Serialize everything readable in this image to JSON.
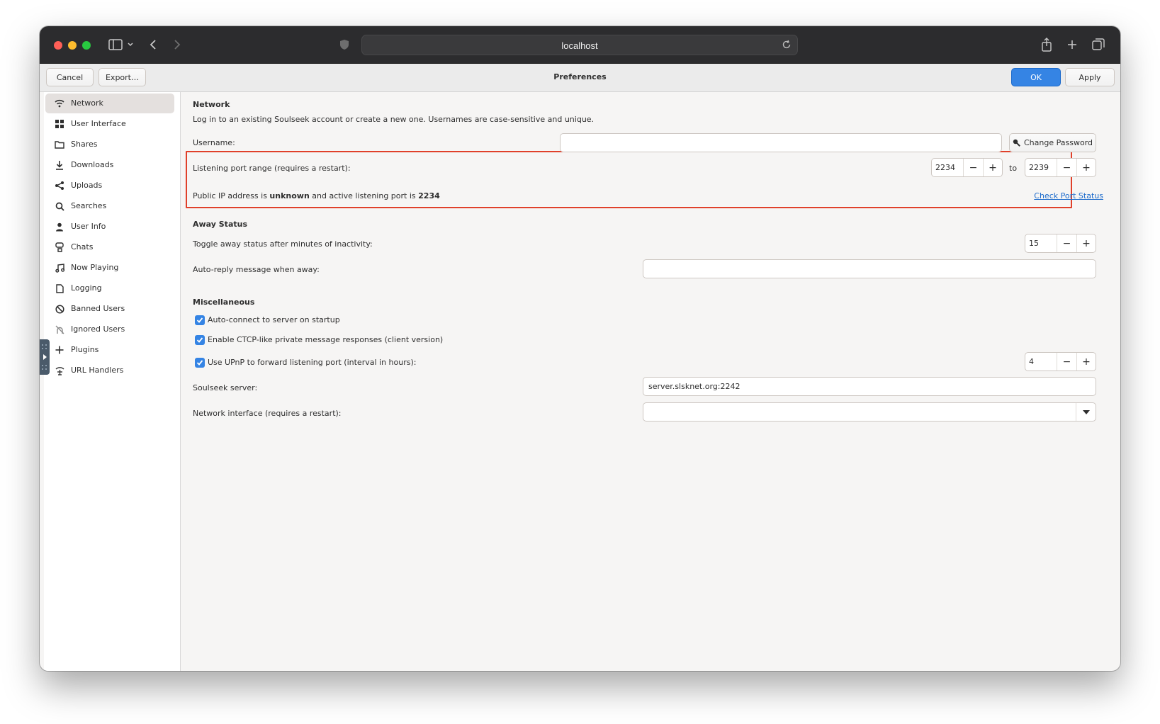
{
  "browser": {
    "url": "localhost"
  },
  "header": {
    "cancel_label": "Cancel",
    "export_label": "Export…",
    "title": "Preferences",
    "ok_label": "OK",
    "apply_label": "Apply"
  },
  "sidebar": {
    "items": [
      {
        "label": "Network",
        "icon": "wifi-icon",
        "active": true
      },
      {
        "label": "User Interface",
        "icon": "grid-icon"
      },
      {
        "label": "Shares",
        "icon": "folder-icon"
      },
      {
        "label": "Downloads",
        "icon": "download-icon"
      },
      {
        "label": "Uploads",
        "icon": "share-icon"
      },
      {
        "label": "Searches",
        "icon": "search-icon"
      },
      {
        "label": "User Info",
        "icon": "person-icon"
      },
      {
        "label": "Chats",
        "icon": "chat-icon"
      },
      {
        "label": "Now Playing",
        "icon": "music-icon"
      },
      {
        "label": "Logging",
        "icon": "document-icon"
      },
      {
        "label": "Banned Users",
        "icon": "ban-icon"
      },
      {
        "label": "Ignored Users",
        "icon": "ignore-icon"
      },
      {
        "label": "Plugins",
        "icon": "plus-icon"
      },
      {
        "label": "URL Handlers",
        "icon": "url-handler-icon"
      }
    ]
  },
  "network": {
    "title": "Network",
    "description": "Log in to an existing Soulseek account or create a new one. Usernames are case-sensitive and unique.",
    "username_label": "Username:",
    "username_value": "",
    "change_password_label": "Change Password",
    "port_label": "Listening port range (requires a restart):",
    "port_from": "2234",
    "port_to_label": "to",
    "port_to": "2239",
    "public_ip_prefix": "Public IP address is ",
    "public_ip_value": "unknown",
    "public_ip_middle": " and active listening port is ",
    "active_port": "2234",
    "check_port_label": "Check Port Status"
  },
  "away": {
    "title": "Away Status",
    "toggle_label": "Toggle away status after minutes of inactivity:",
    "toggle_minutes": "15",
    "autoreply_label": "Auto-reply message when away:",
    "autoreply_value": ""
  },
  "misc": {
    "title": "Miscellaneous",
    "autoconnect_label": "Auto-connect to server on startup",
    "autoconnect_checked": true,
    "ctcp_label": "Enable CTCP-like private message responses (client version)",
    "ctcp_checked": true,
    "upnp_label": "Use UPnP to forward listening port (interval in hours):",
    "upnp_checked": true,
    "upnp_interval": "4",
    "server_label": "Soulseek server:",
    "server_value": "server.slsknet.org:2242",
    "interface_label": "Network interface (requires a restart):",
    "interface_value": ""
  },
  "colors": {
    "accent": "#3584e4",
    "highlight_border": "#e0402a",
    "link": "#1b6acb"
  }
}
